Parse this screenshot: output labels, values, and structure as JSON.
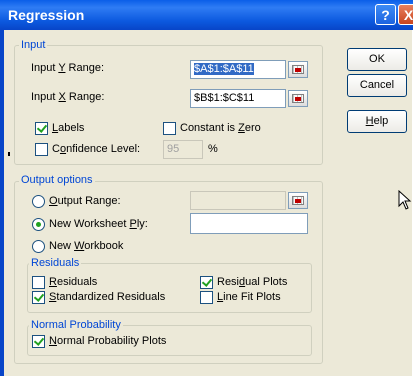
{
  "window": {
    "title": "Regression",
    "help_glyph": "?",
    "close_glyph": "X"
  },
  "buttons": {
    "ok": "OK",
    "cancel": "Cancel",
    "help": "Help"
  },
  "input": {
    "group_label": "Input",
    "y_range_label": "Input Y Range:",
    "y_range_value": "$A$1:$A$11",
    "x_range_label": "Input X Range:",
    "x_range_value": "$B$1:$C$11",
    "labels": {
      "label": "Labels",
      "checked": true
    },
    "constant_zero": {
      "label": "Constant is Zero",
      "checked": false
    },
    "confidence": {
      "label": "Confidence Level:",
      "checked": false,
      "value": "95",
      "unit": "%"
    }
  },
  "output": {
    "group_label": "Output options",
    "output_range": {
      "label": "Output Range:",
      "selected": false,
      "value": ""
    },
    "new_ply": {
      "label": "New Worksheet Ply:",
      "selected": true,
      "value": ""
    },
    "new_workbook": {
      "label": "New Workbook",
      "selected": false
    }
  },
  "residuals": {
    "group_label": "Residuals",
    "residuals": {
      "label": "Residuals",
      "checked": false
    },
    "standardized": {
      "label": "Standardized Residuals",
      "checked": true
    },
    "residual_plots": {
      "label": "Residual Plots",
      "checked": true
    },
    "line_fit": {
      "label": "Line Fit Plots",
      "checked": false
    }
  },
  "normal_probability": {
    "group_label": "Normal Probability",
    "plots": {
      "label": "Normal Probability Plots",
      "checked": true
    }
  },
  "cursor": "mouse-pointer-icon"
}
